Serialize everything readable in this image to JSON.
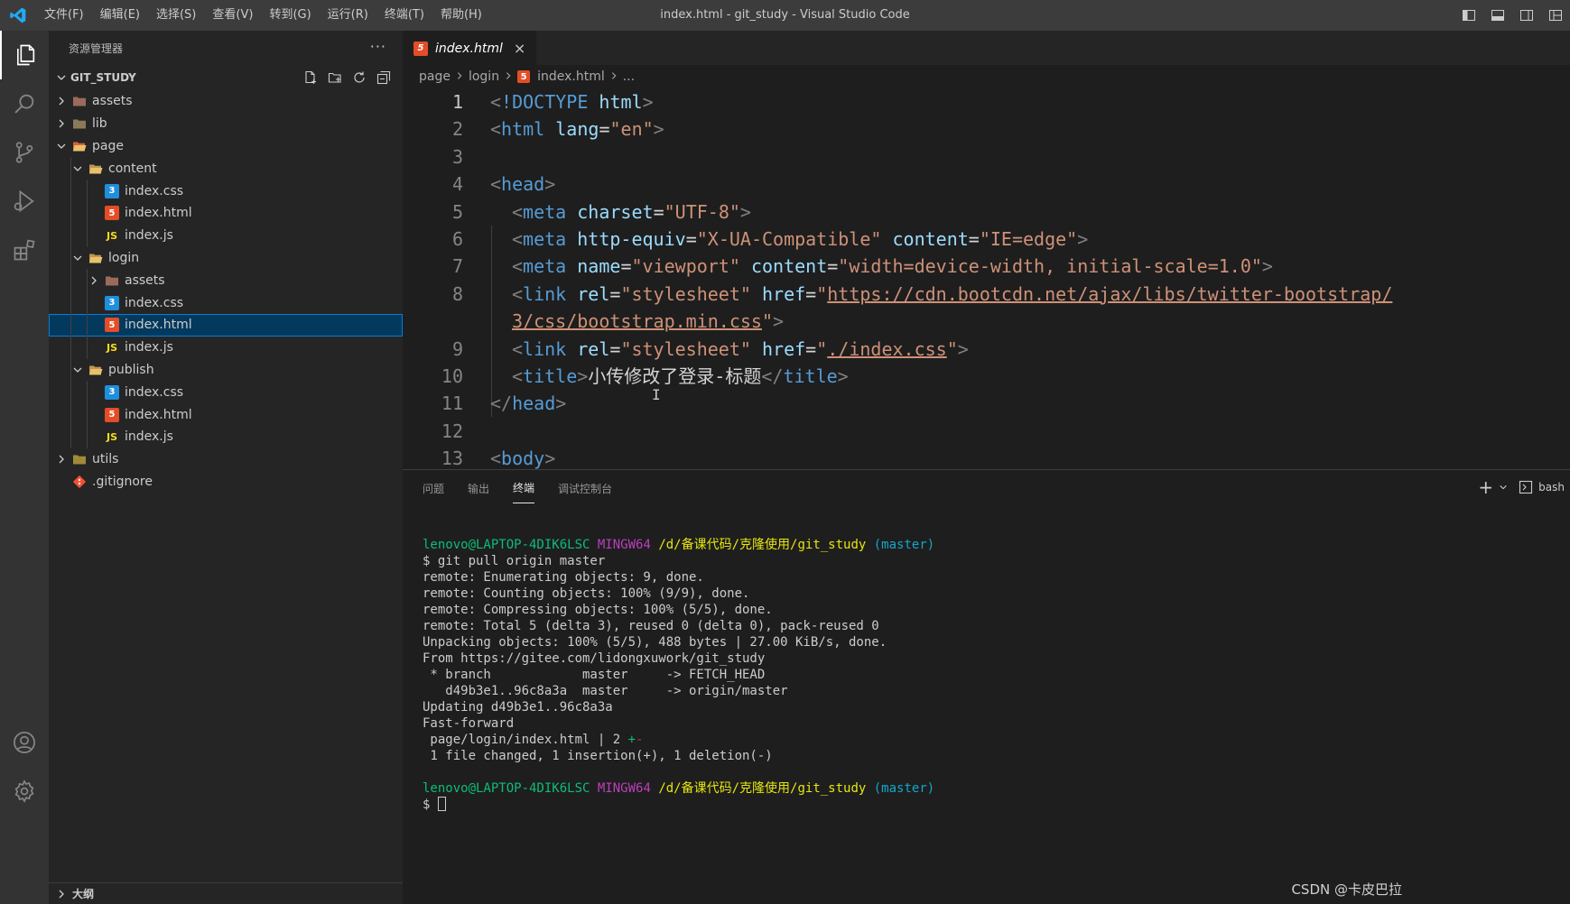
{
  "window": {
    "title": "index.html - git_study - Visual Studio Code",
    "menu": [
      "文件(F)",
      "编辑(E)",
      "选择(S)",
      "查看(V)",
      "转到(G)",
      "运行(R)",
      "终端(T)",
      "帮助(H)"
    ]
  },
  "activity_bar": [
    "explorer-icon",
    "search-icon",
    "source-control-icon",
    "run-debug-icon",
    "extensions-icon",
    "account-icon",
    "settings-gear-icon"
  ],
  "sidebar": {
    "title": "资源管理器",
    "more": "···",
    "root": "GIT_STUDY",
    "outline": "大纲",
    "tree": [
      {
        "label": "assets",
        "type": "folder",
        "level": 0,
        "expanded": false
      },
      {
        "label": "lib",
        "type": "folder",
        "level": 0,
        "expanded": false
      },
      {
        "label": "page",
        "type": "folder",
        "level": 0,
        "expanded": true
      },
      {
        "label": "content",
        "type": "folder",
        "level": 1,
        "expanded": true
      },
      {
        "label": "index.css",
        "type": "css",
        "level": 2
      },
      {
        "label": "index.html",
        "type": "html",
        "level": 2
      },
      {
        "label": "index.js",
        "type": "js",
        "level": 2
      },
      {
        "label": "login",
        "type": "folder",
        "level": 1,
        "expanded": true
      },
      {
        "label": "assets",
        "type": "folder",
        "level": 2,
        "expanded": false
      },
      {
        "label": "index.css",
        "type": "css",
        "level": 2
      },
      {
        "label": "index.html",
        "type": "html",
        "level": 2,
        "selected": true
      },
      {
        "label": "index.js",
        "type": "js",
        "level": 2
      },
      {
        "label": "publish",
        "type": "folder",
        "level": 1,
        "expanded": true
      },
      {
        "label": "index.css",
        "type": "css",
        "level": 2
      },
      {
        "label": "index.html",
        "type": "html",
        "level": 2
      },
      {
        "label": "index.js",
        "type": "js",
        "level": 2
      },
      {
        "label": "utils",
        "type": "folder",
        "level": 0,
        "expanded": false
      },
      {
        "label": ".gitignore",
        "type": "git",
        "level": 0
      }
    ]
  },
  "editor": {
    "tab": {
      "label": "index.html",
      "close": "×"
    },
    "breadcrumb": [
      "page",
      "login",
      "index.html",
      "..."
    ],
    "lines": [
      {
        "n": "1",
        "cur": true,
        "parts": [
          [
            "br",
            "<"
          ],
          [
            "tag",
            "!DOCTYPE"
          ],
          [
            "txt",
            " "
          ],
          [
            "attr",
            "html"
          ],
          [
            "br",
            ">"
          ]
        ]
      },
      {
        "n": "2",
        "parts": [
          [
            "br",
            "<"
          ],
          [
            "tag",
            "html"
          ],
          [
            "txt",
            " "
          ],
          [
            "attr",
            "lang"
          ],
          [
            "txt",
            "="
          ],
          [
            "str",
            "\"en\""
          ],
          [
            "br",
            ">"
          ]
        ]
      },
      {
        "n": "3",
        "parts": []
      },
      {
        "n": "4",
        "parts": [
          [
            "br",
            "<"
          ],
          [
            "tag",
            "head"
          ],
          [
            "br",
            ">"
          ]
        ]
      },
      {
        "n": "5",
        "indent": 1,
        "parts": [
          [
            "br",
            "<"
          ],
          [
            "tag",
            "meta"
          ],
          [
            "txt",
            " "
          ],
          [
            "attr",
            "charset"
          ],
          [
            "txt",
            "="
          ],
          [
            "str",
            "\"UTF-8\""
          ],
          [
            "br",
            ">"
          ]
        ]
      },
      {
        "n": "6",
        "indent": 1,
        "parts": [
          [
            "br",
            "<"
          ],
          [
            "tag",
            "meta"
          ],
          [
            "txt",
            " "
          ],
          [
            "attr",
            "http-equiv"
          ],
          [
            "txt",
            "="
          ],
          [
            "str",
            "\"X-UA-Compatible\""
          ],
          [
            "txt",
            " "
          ],
          [
            "attr",
            "content"
          ],
          [
            "txt",
            "="
          ],
          [
            "str",
            "\"IE=edge\""
          ],
          [
            "br",
            ">"
          ]
        ]
      },
      {
        "n": "7",
        "indent": 1,
        "parts": [
          [
            "br",
            "<"
          ],
          [
            "tag",
            "meta"
          ],
          [
            "txt",
            " "
          ],
          [
            "attr",
            "name"
          ],
          [
            "txt",
            "="
          ],
          [
            "str",
            "\"viewport\""
          ],
          [
            "txt",
            " "
          ],
          [
            "attr",
            "content"
          ],
          [
            "txt",
            "="
          ],
          [
            "str",
            "\"width=device-width, initial-scale=1.0\""
          ],
          [
            "br",
            ">"
          ]
        ]
      },
      {
        "n": "8",
        "indent": 1,
        "parts": [
          [
            "br",
            "<"
          ],
          [
            "tag",
            "link"
          ],
          [
            "txt",
            " "
          ],
          [
            "attr",
            "rel"
          ],
          [
            "txt",
            "="
          ],
          [
            "str",
            "\"stylesheet\""
          ],
          [
            "txt",
            " "
          ],
          [
            "attr",
            "href"
          ],
          [
            "txt",
            "="
          ],
          [
            "str",
            "\""
          ],
          [
            "link",
            "https://cdn.bootcdn.net/ajax/libs/twitter-bootstrap/"
          ]
        ]
      },
      {
        "n": "",
        "indent": 1,
        "parts": [
          [
            "link",
            "3/css/bootstrap.min.css"
          ],
          [
            "str",
            "\""
          ],
          [
            "br",
            ">"
          ]
        ]
      },
      {
        "n": "9",
        "indent": 1,
        "parts": [
          [
            "br",
            "<"
          ],
          [
            "tag",
            "link"
          ],
          [
            "txt",
            " "
          ],
          [
            "attr",
            "rel"
          ],
          [
            "txt",
            "="
          ],
          [
            "str",
            "\"stylesheet\""
          ],
          [
            "txt",
            " "
          ],
          [
            "attr",
            "href"
          ],
          [
            "txt",
            "="
          ],
          [
            "str",
            "\""
          ],
          [
            "link",
            "./index.css"
          ],
          [
            "str",
            "\""
          ],
          [
            "br",
            ">"
          ]
        ]
      },
      {
        "n": "10",
        "indent": 1,
        "parts": [
          [
            "br",
            "<"
          ],
          [
            "tag",
            "title"
          ],
          [
            "br",
            ">"
          ],
          [
            "txt",
            "小传修改了登录-标题"
          ],
          [
            "br",
            "</"
          ],
          [
            "tag",
            "title"
          ],
          [
            "br",
            ">"
          ]
        ]
      },
      {
        "n": "11",
        "parts": [
          [
            "br",
            "</"
          ],
          [
            "tag",
            "head"
          ],
          [
            "br",
            ">"
          ]
        ]
      },
      {
        "n": "12",
        "parts": []
      },
      {
        "n": "13",
        "parts": [
          [
            "br",
            "<"
          ],
          [
            "tag",
            "body"
          ],
          [
            "br",
            ">"
          ]
        ]
      }
    ]
  },
  "panel": {
    "tabs": [
      "问题",
      "输出",
      "终端",
      "调试控制台"
    ],
    "active_tab": "终端",
    "add": "+",
    "shell": "bash",
    "terminal": [
      [
        [
          "green",
          "lenovo@LAPTOP-4DIK6LSC "
        ],
        [
          "mag",
          "MINGW64 "
        ],
        [
          "yel",
          "/d/备课代码/克隆使用/git_study "
        ],
        [
          "cyan",
          "(master)"
        ]
      ],
      [
        [
          "plain",
          "$ git pull origin master"
        ]
      ],
      [
        [
          "plain",
          "remote: Enumerating objects: 9, done."
        ]
      ],
      [
        [
          "plain",
          "remote: Counting objects: 100% (9/9), done."
        ]
      ],
      [
        [
          "plain",
          "remote: Compressing objects: 100% (5/5), done."
        ]
      ],
      [
        [
          "plain",
          "remote: Total 5 (delta 3), reused 0 (delta 0), pack-reused 0"
        ]
      ],
      [
        [
          "plain",
          "Unpacking objects: 100% (5/5), 488 bytes | 27.00 KiB/s, done."
        ]
      ],
      [
        [
          "plain",
          "From https://gitee.com/lidongxuwork/git_study"
        ]
      ],
      [
        [
          "plain",
          " * branch            master     -> FETCH_HEAD"
        ]
      ],
      [
        [
          "plain",
          "   d49b3e1..96c8a3a  master     -> origin/master"
        ]
      ],
      [
        [
          "plain",
          "Updating d49b3e1..96c8a3a"
        ]
      ],
      [
        [
          "plain",
          "Fast-forward"
        ]
      ],
      [
        [
          "plain",
          " page/login/index.html | 2 "
        ],
        [
          "green",
          "+"
        ],
        [
          "red",
          "-"
        ]
      ],
      [
        [
          "plain",
          " 1 file changed, 1 insertion(+), 1 deletion(-)"
        ]
      ],
      [
        [
          "plain",
          ""
        ]
      ],
      [
        [
          "green",
          "lenovo@LAPTOP-4DIK6LSC "
        ],
        [
          "mag",
          "MINGW64 "
        ],
        [
          "yel",
          "/d/备课代码/克隆使用/git_study "
        ],
        [
          "cyan",
          "(master)"
        ]
      ],
      [
        [
          "plain",
          "$ "
        ],
        [
          "cursor",
          ""
        ]
      ]
    ]
  },
  "watermark": "CSDN @卡皮巴拉",
  "colors": {
    "accent": "#007acc",
    "selection": "#04395e",
    "html_icon": "#e44d26",
    "css_icon": "#1f8fdb",
    "js_icon": "#f5de19"
  }
}
